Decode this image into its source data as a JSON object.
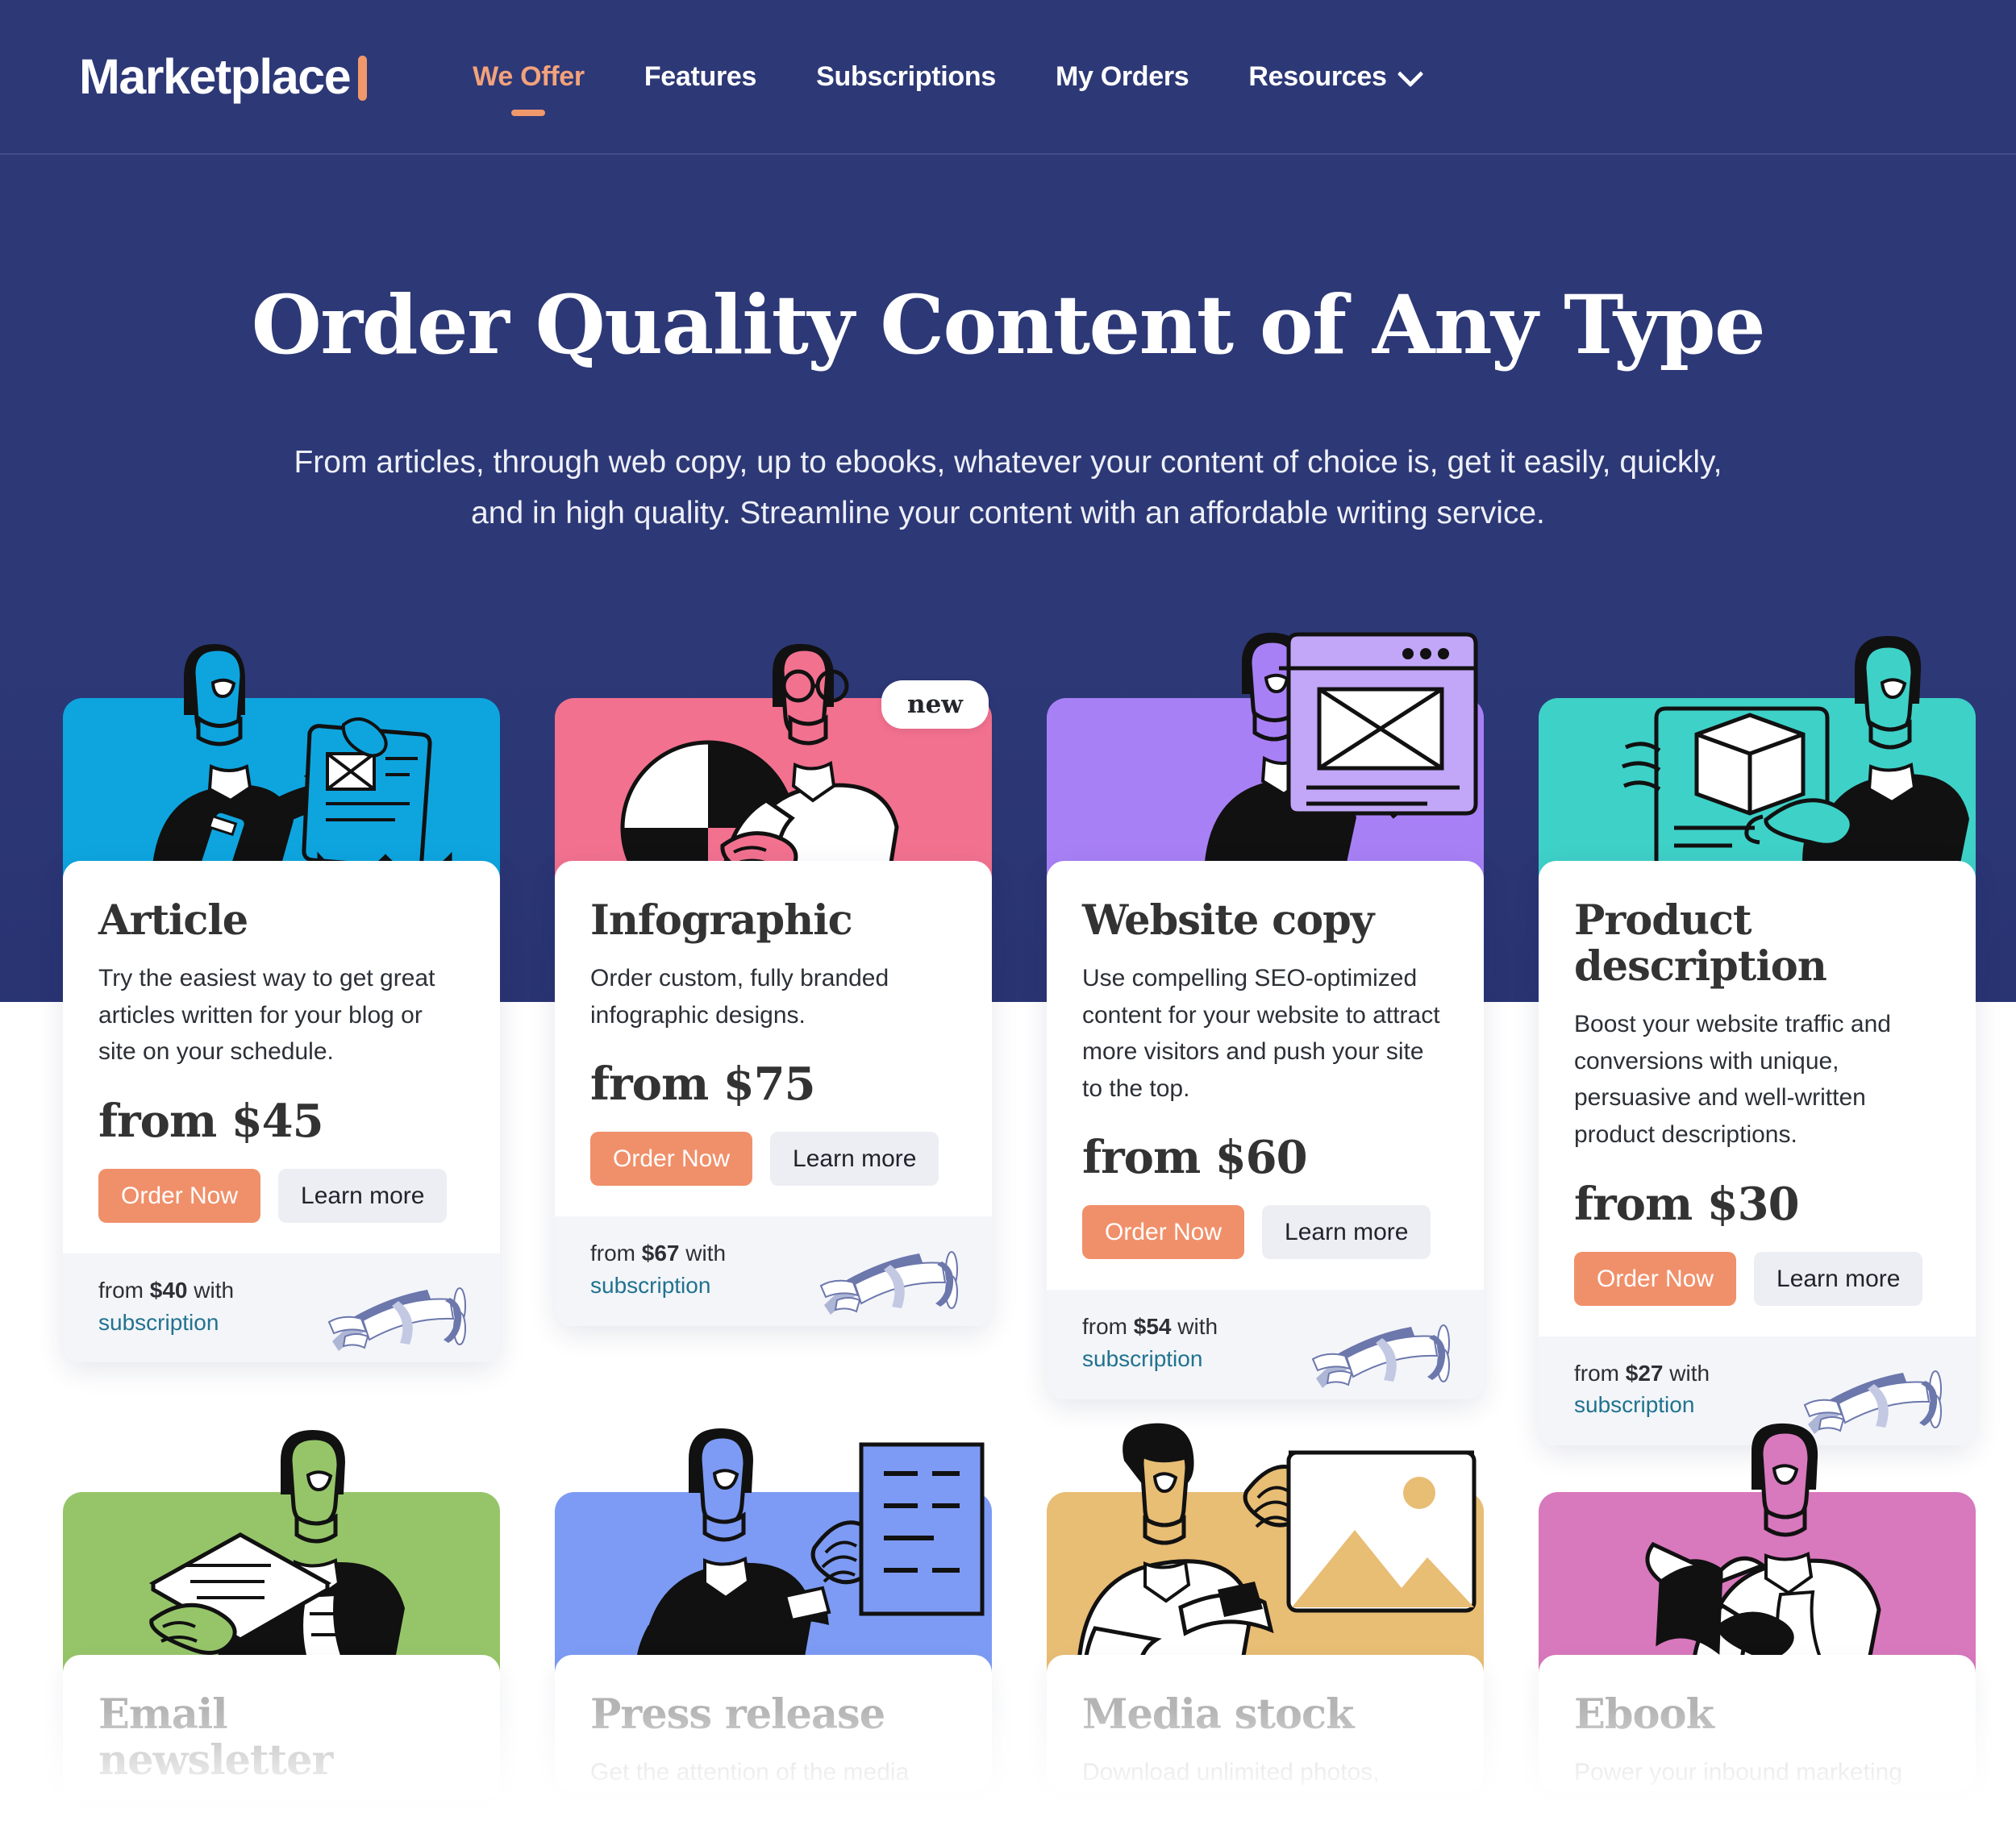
{
  "brand": {
    "name": "Marketplace",
    "accent_color": "#f0986b",
    "nav_bg": "#2d3876"
  },
  "nav": {
    "items": [
      {
        "label": "We Offer",
        "active": true,
        "has_chevron": false
      },
      {
        "label": "Features",
        "active": false,
        "has_chevron": false
      },
      {
        "label": "Subscriptions",
        "active": false,
        "has_chevron": false
      },
      {
        "label": "My Orders",
        "active": false,
        "has_chevron": false
      },
      {
        "label": "Resources",
        "active": false,
        "has_chevron": true
      }
    ]
  },
  "hero": {
    "title": "Order Quality Content of Any Type",
    "subtitle": "From articles, through web copy, up to ebooks, whatever your content of choice is, get it easily, quickly, and in high quality. Streamline your content with an affordable writing service."
  },
  "labels": {
    "order_now": "Order Now",
    "learn_more": "Learn more",
    "new_badge": "new",
    "subscription_link": "subscription"
  },
  "cards": [
    {
      "title": "Article",
      "description": "Try the easiest way to get great articles written for your blog or site on your schedule.",
      "price": "from $45",
      "sub_prefix": "from ",
      "sub_price": "$40",
      "sub_suffix": " with",
      "sub_link": "subscription",
      "art_color": "#0ea5df",
      "badge": null,
      "art": "article-illustration"
    },
    {
      "title": "Infographic",
      "description": "Order custom, fully branded infographic designs.",
      "price": "from $75",
      "sub_prefix": "from ",
      "sub_price": "$67",
      "sub_suffix": " with",
      "sub_link": "subscription",
      "art_color": "#f2718f",
      "badge": "new",
      "art": "infographic-illustration"
    },
    {
      "title": "Website copy",
      "description": "Use compelling SEO-optimized content for your website to attract more visitors and push your site to the top.",
      "price": "from $60",
      "sub_prefix": "from ",
      "sub_price": "$54",
      "sub_suffix": " with",
      "sub_link": "subscription",
      "art_color": "#a880f5",
      "badge": null,
      "art": "website-copy-illustration"
    },
    {
      "title": "Product description",
      "description": "Boost your website traffic and conversions with unique, persuasive and well-written product descriptions.",
      "price": "from $30",
      "sub_prefix": "from ",
      "sub_price": "$27",
      "sub_suffix": " with",
      "sub_link": "subscription",
      "art_color": "#3ed1c8",
      "badge": null,
      "art": "product-description-illustration"
    }
  ],
  "cards_row2": [
    {
      "title": "Email newsletter",
      "description": "",
      "art_color": "#96c569",
      "art": "email-newsletter-illustration"
    },
    {
      "title": "Press release",
      "description": "Get the attention of the media",
      "art_color": "#7d9bf4",
      "art": "press-release-illustration"
    },
    {
      "title": "Media stock",
      "description": "Download unlimited photos,",
      "art_color": "#e8bd74",
      "art": "media-stock-illustration"
    },
    {
      "title": "Ebook",
      "description": "Power your inbound marketing",
      "art_color": "#d878bd",
      "art": "ebook-illustration"
    }
  ]
}
